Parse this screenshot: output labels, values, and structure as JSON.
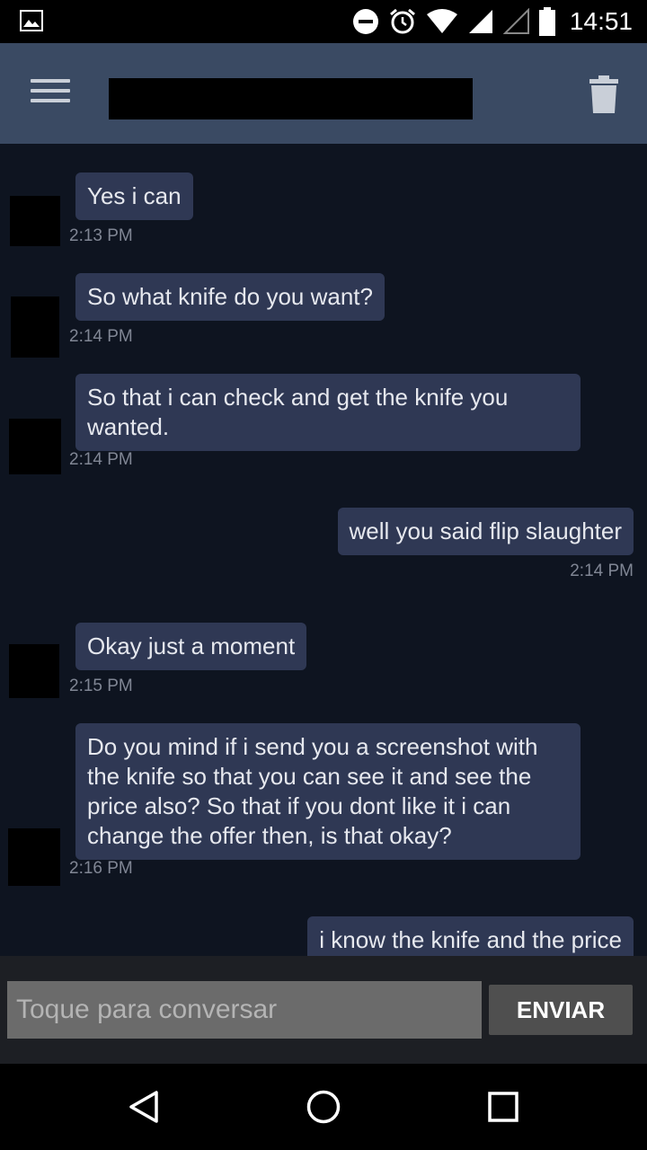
{
  "status_bar": {
    "time": "14:51",
    "icons": [
      "image-notification-icon",
      "do-not-disturb-icon",
      "alarm-icon",
      "wifi-icon",
      "cell-signal-icon",
      "cell-signal-empty-icon",
      "battery-icon"
    ]
  },
  "toolbar": {
    "menu_icon": "hamburger-menu-icon",
    "delete_icon": "trash-icon"
  },
  "messages": [
    {
      "text": "Yes i can",
      "time": "2:13 PM",
      "side": "received"
    },
    {
      "text": "So what knife do you want?",
      "time": "2:14 PM",
      "side": "received"
    },
    {
      "text": "So that i can check and get the knife you wanted.",
      "time": "2:14 PM",
      "side": "received"
    },
    {
      "text": "well you said flip slaughter",
      "time": "2:14 PM",
      "side": "sent"
    },
    {
      "text": "Okay just a moment",
      "time": "2:15 PM",
      "side": "received"
    },
    {
      "text": "Do you mind if i send you a screenshot with the knife so that you can see it and see the price also? So that if you dont like it i can change the offer then, is that okay?",
      "time": "2:16 PM",
      "side": "received"
    },
    {
      "text": "i know the knife and the price",
      "time": "",
      "side": "sent"
    }
  ],
  "composer": {
    "placeholder": "Toque para conversar",
    "value": "",
    "send_label": "ENVIAR"
  },
  "nav_bar": {
    "icons": [
      "back-icon",
      "home-icon",
      "recents-icon"
    ]
  },
  "colors": {
    "toolbar_bg": "#3a4a63",
    "chat_bg": "#0e1420",
    "bubble_bg": "#2f3854",
    "timestamp": "#808694"
  }
}
